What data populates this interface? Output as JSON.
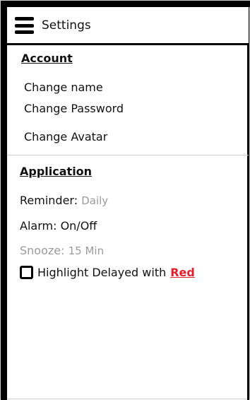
{
  "header": {
    "title": "Settings",
    "menu_icon": "hamburger-menu-icon"
  },
  "account": {
    "section_title": "Account",
    "items": [
      {
        "label": "Change name"
      },
      {
        "label": "Change Password"
      },
      {
        "label": "Change Avatar"
      }
    ]
  },
  "application": {
    "section_title": "Application",
    "reminder": {
      "label": "Reminder:",
      "value": "Daily"
    },
    "alarm": {
      "label": "Alarm:",
      "value": "On/Off"
    },
    "snooze": {
      "label": "Snooze:",
      "value": "15 Min"
    },
    "highlight": {
      "checkbox_checked": false,
      "label": "Highlight Delayed with",
      "color_label": "Red",
      "color_hex": "#e0202a"
    }
  }
}
